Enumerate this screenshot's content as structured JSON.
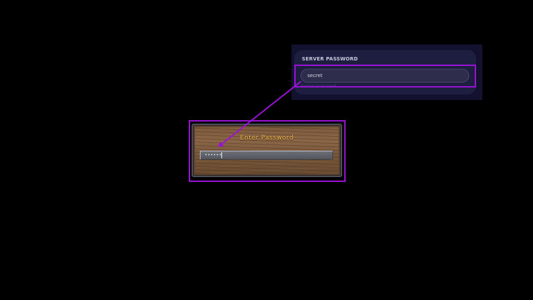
{
  "settings_panel": {
    "title": "SERVER PASSWORD",
    "password_value": "secret",
    "hint": "Server password"
  },
  "game_dialog": {
    "title": "Enter Password",
    "masked_value": "••••••"
  },
  "colors": {
    "highlight": "#9a12d6",
    "dialog_title": "#f2b84a",
    "panel_background": "#1e1e40"
  },
  "icons": {
    "connector": "arrow-icon"
  }
}
